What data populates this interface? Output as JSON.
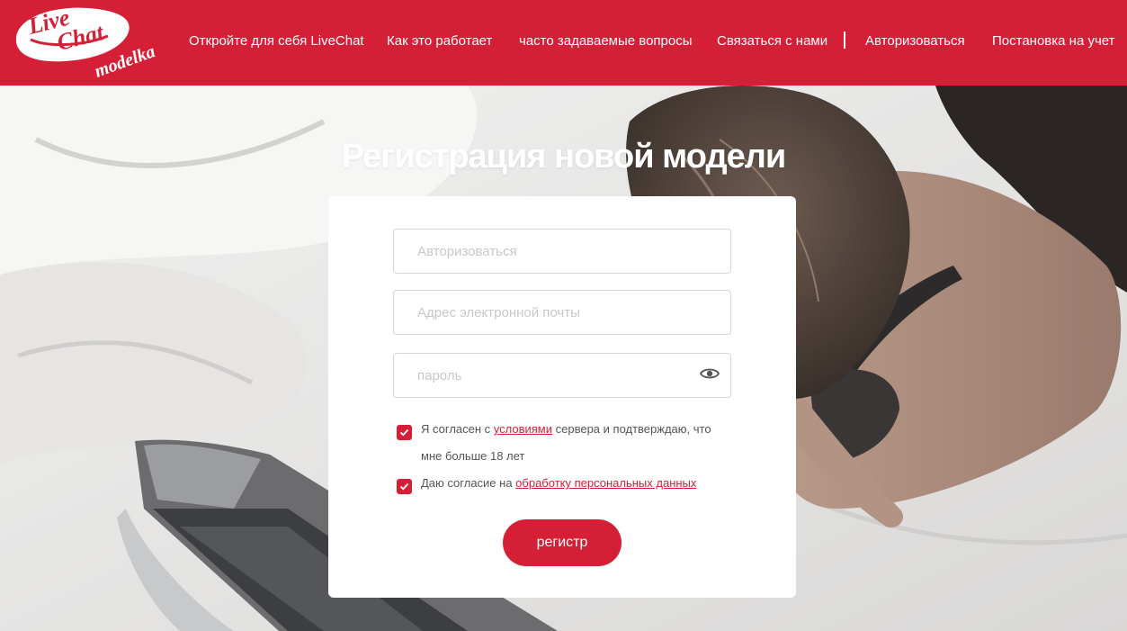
{
  "brand": {
    "logo_text_line1": "Live",
    "logo_text_line2": "Chat",
    "logo_text_line3": "modelka",
    "color_primary": "#d51f36"
  },
  "nav": {
    "items": [
      {
        "label": "Откройте для себя LiveChat"
      },
      {
        "label": "Как это работает"
      },
      {
        "label": "часто задаваемые вопросы"
      },
      {
        "label": "Связаться с нами"
      },
      {
        "label": "Авторизоваться"
      },
      {
        "label": "Постановка на учет"
      }
    ]
  },
  "page": {
    "title": "Регистрация новой модели"
  },
  "form": {
    "username_placeholder": "Авторизоваться",
    "username_value": "",
    "email_placeholder": "Адрес электронной почты",
    "email_value": "",
    "password_placeholder": "пароль",
    "password_value": "",
    "password_toggle_icon": "eye-icon",
    "terms": {
      "checked": true,
      "text_before": "Я согласен с ",
      "link": "условиями",
      "text_after": " сервера и подтверждаю, что мне больше 18 лет"
    },
    "privacy": {
      "checked": true,
      "text_before": "Даю согласие на ",
      "link": "обработку персональных данных"
    },
    "submit_label": "регистр"
  }
}
